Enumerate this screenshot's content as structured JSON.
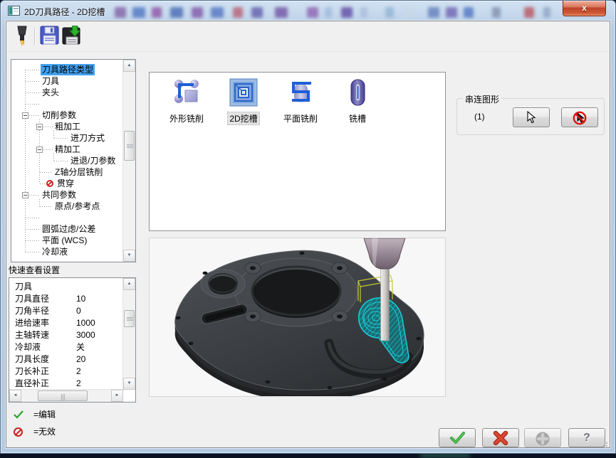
{
  "window": {
    "title": "2D刀具路径 - 2D挖槽",
    "close_glyph": "x",
    "icons": [
      "window-icon",
      "close-icon"
    ]
  },
  "toolbar": {
    "icons": [
      "endmill-tool-icon",
      "save-icon",
      "save-export-icon"
    ]
  },
  "tree": {
    "items": [
      {
        "label": "刀具路径类型",
        "selected": true
      },
      {
        "label": "刀具"
      },
      {
        "label": "夹头"
      },
      {
        "label": ""
      },
      {
        "label": "切削参数",
        "expanded": true
      },
      {
        "label": "粗加工",
        "expanded": true
      },
      {
        "label": "进刀方式"
      },
      {
        "label": "精加工",
        "expanded": true
      },
      {
        "label": "进退/刀参数"
      },
      {
        "label": "Z轴分层铣削"
      },
      {
        "label": "贯穿",
        "status": "invalid"
      },
      {
        "label": "共同参数",
        "expanded": true
      },
      {
        "label": "原点/参考点"
      },
      {
        "label": ""
      },
      {
        "label": "圆弧过虑/公差"
      },
      {
        "label": "平面 (WCS)"
      },
      {
        "label": "冷却液"
      }
    ]
  },
  "quick_view": {
    "title": "快速查看设置",
    "rows": [
      {
        "name": "刀具",
        "value": ""
      },
      {
        "name": "刀具直径",
        "value": "10"
      },
      {
        "name": "刀角半径",
        "value": "0"
      },
      {
        "name": "进给速率",
        "value": "1000"
      },
      {
        "name": "主轴转速",
        "value": "3000"
      },
      {
        "name": "冷却液",
        "value": "关"
      },
      {
        "name": "刀具长度",
        "value": "20"
      },
      {
        "name": "刀长补正",
        "value": "2"
      },
      {
        "name": "直径补正",
        "value": "2"
      }
    ]
  },
  "legend": {
    "edit": "=编辑",
    "invalid": "=无效",
    "icons": [
      "check-icon",
      "no-entry-icon"
    ]
  },
  "toolpath_types": {
    "items": [
      {
        "label": "外形铣削",
        "icon": "contour-mill-icon"
      },
      {
        "label": "2D挖槽",
        "icon": "pocket-2d-icon",
        "selected": true
      },
      {
        "label": "平面铣削",
        "icon": "face-mill-icon"
      },
      {
        "label": "铣槽",
        "icon": "slot-mill-icon"
      }
    ]
  },
  "chain": {
    "title": "串连图形",
    "count": "(1)",
    "buttons": [
      {
        "icon": "select-cursor-icon"
      },
      {
        "icon": "deselect-cursor-icon"
      }
    ]
  },
  "dialog_buttons": [
    {
      "icon": "ok-check-icon"
    },
    {
      "icon": "cancel-x-icon"
    },
    {
      "icon": "apply-plus-icon",
      "disabled": true
    },
    {
      "icon": "help-question-icon",
      "glyph": "?"
    }
  ],
  "colors": {
    "selection_blue": "#42a1f0",
    "ok_green": "#35b335",
    "cancel_red": "#d64530",
    "invalid_red": "#cc2222",
    "toolpath_cyan": "#14d2dc",
    "titlebar_glass": "#c6d9ee"
  }
}
